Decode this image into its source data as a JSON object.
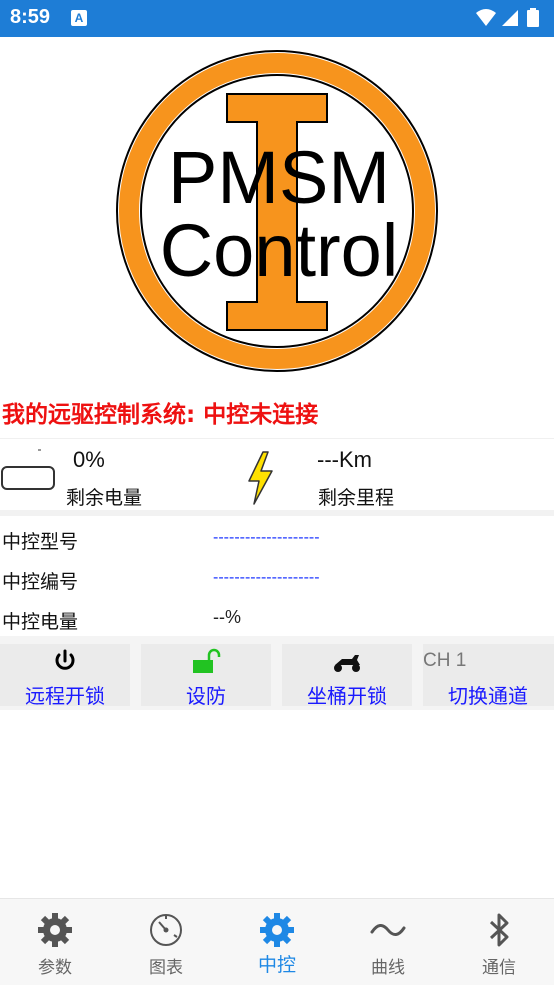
{
  "status_bar": {
    "time": "8:59",
    "notification_icon": "A"
  },
  "logo": {
    "line1": "PMSM",
    "line2": "Control",
    "ring_color": "#f7941d"
  },
  "title": "我的远驱控制系统: 中控未连接",
  "info": {
    "charge_value": "0%",
    "charge_label": "剩余电量",
    "range_value": "---Km",
    "range_label": "剩余里程"
  },
  "details": [
    {
      "label": "中控型号",
      "value": "--------------------"
    },
    {
      "label": "中控编号",
      "value": "--------------------"
    },
    {
      "label": "中控电量",
      "value": "--%"
    }
  ],
  "actions": {
    "remote_unlock": "远程开锁",
    "arm": "设防",
    "seat_unlock": "坐桶开锁",
    "channel": "CH 1",
    "switch_channel": "切换通道"
  },
  "nav": {
    "items": [
      {
        "label": "参数",
        "icon": "gear-icon"
      },
      {
        "label": "图表",
        "icon": "gauge-icon"
      },
      {
        "label": "中控",
        "icon": "gear-icon"
      },
      {
        "label": "曲线",
        "icon": "wave-icon"
      },
      {
        "label": "通信",
        "icon": "bluetooth-icon"
      }
    ],
    "active_index": 2,
    "active_color": "#1e88e5"
  }
}
